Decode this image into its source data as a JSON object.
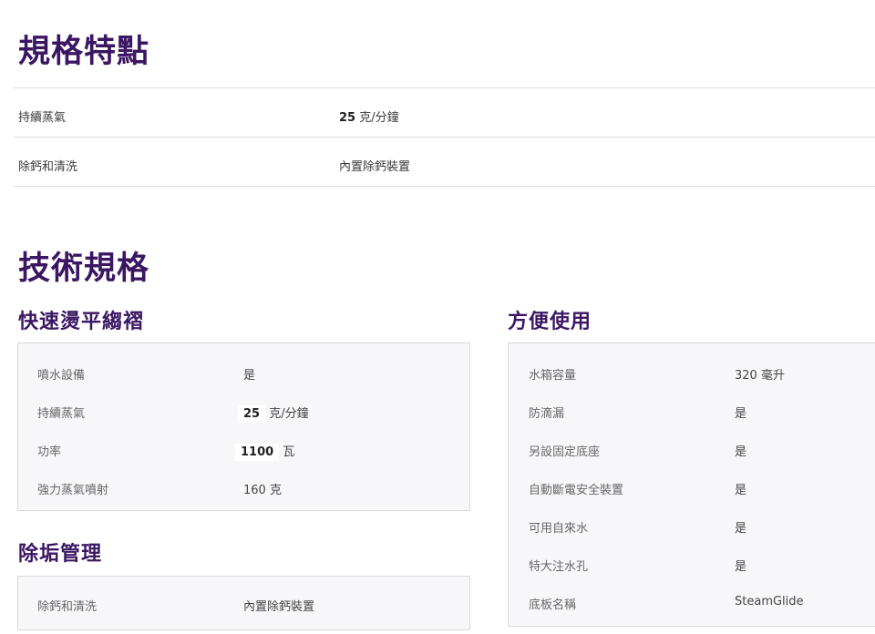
{
  "spec_features": {
    "title": "規格特點",
    "rows": [
      {
        "label": "持續蒸氣",
        "num": "25",
        "unit": "克/分鐘"
      },
      {
        "label": "除鈣和清洗",
        "value": "內置除鈣裝置"
      }
    ]
  },
  "tech_specs": {
    "title": "技術規格",
    "fast_ironing": {
      "title": "快速燙平縐褶",
      "rows": [
        {
          "label": "噴水設備",
          "value": "是"
        },
        {
          "label": "持續蒸氣",
          "num": "25",
          "unit": "克/分鐘"
        },
        {
          "label": "功率",
          "num": "1100",
          "unit": "瓦"
        },
        {
          "label": "強力蒸氣噴射",
          "value": "160 克"
        }
      ]
    },
    "descaling": {
      "title": "除垢管理",
      "rows": [
        {
          "label": "除鈣和清洗",
          "value": "內置除鈣裝置"
        }
      ]
    },
    "convenience": {
      "title": "方便使用",
      "rows": [
        {
          "label": "水箱容量",
          "value": "320 毫升"
        },
        {
          "label": "防滴漏",
          "value": "是"
        },
        {
          "label": "另設固定底座",
          "value": "是"
        },
        {
          "label": "自動斷電安全裝置",
          "value": "是"
        },
        {
          "label": "可用自來水",
          "value": "是"
        },
        {
          "label": "特大注水孔",
          "value": "是"
        },
        {
          "label": "底板名稱",
          "value": "SteamGlide"
        }
      ]
    }
  }
}
